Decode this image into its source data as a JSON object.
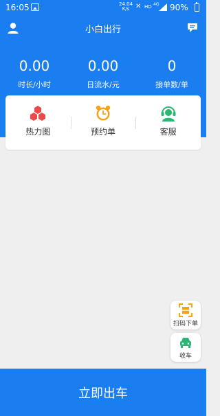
{
  "status_bar": {
    "time": "16:05",
    "speed_value": "24.04",
    "speed_unit": "K/s",
    "hd": "HD",
    "network": "4G",
    "battery": "90%"
  },
  "header": {
    "title": "小白出行",
    "profile_icon": "person-icon",
    "message_icon": "message-icon"
  },
  "stats": [
    {
      "value": "0.00",
      "label": "时长/小时"
    },
    {
      "value": "0.00",
      "label": "日流水/元"
    },
    {
      "value": "0",
      "label": "接单数/单"
    }
  ],
  "quick_actions": [
    {
      "label": "热力图",
      "icon": "heatmap-icon",
      "color": "#e94b4b"
    },
    {
      "label": "预约单",
      "icon": "alarm-clock-icon",
      "color": "#f5a21b"
    },
    {
      "label": "客服",
      "icon": "customer-service-icon",
      "color": "#2bb673"
    }
  ],
  "floating_buttons": [
    {
      "label": "扫码下单",
      "icon": "scan-icon",
      "color": "#f5a21b"
    },
    {
      "label": "收车",
      "icon": "car-icon",
      "color": "#2bb673"
    }
  ],
  "primary_action": {
    "label": "立即出车"
  },
  "colors": {
    "brand": "#1a7ef0",
    "background": "#efefef"
  }
}
